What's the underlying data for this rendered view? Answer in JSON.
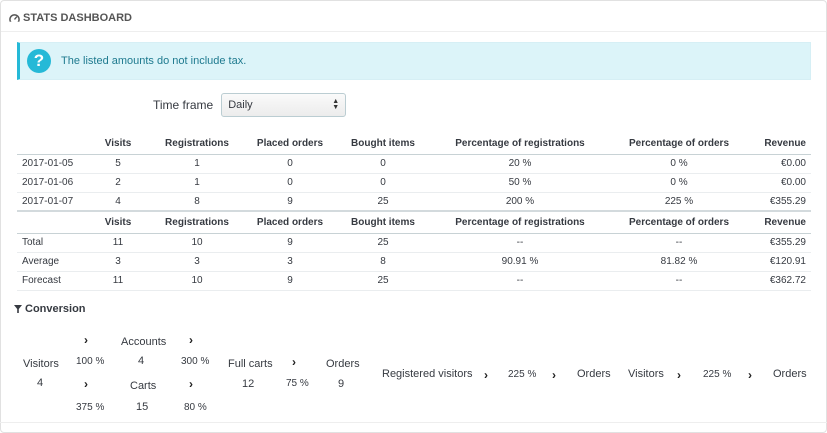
{
  "panel": {
    "title": "Stats Dashboard",
    "icon": "dashboard-icon"
  },
  "alert": {
    "text": "The listed amounts do not include tax.",
    "icon": "question-icon"
  },
  "timeframe": {
    "label": "Time frame",
    "value": "Daily"
  },
  "table": {
    "columns": [
      "",
      "Visits",
      "Registrations",
      "Placed orders",
      "Bought items",
      "Percentage of registrations",
      "Percentage of orders",
      "Revenue"
    ],
    "rows": [
      [
        "2017-01-05",
        "5",
        "1",
        "0",
        "0",
        "20 %",
        "0 %",
        "€0.00"
      ],
      [
        "2017-01-06",
        "2",
        "1",
        "0",
        "0",
        "50 %",
        "0 %",
        "€0.00"
      ],
      [
        "2017-01-07",
        "4",
        "8",
        "9",
        "25",
        "200 %",
        "225 %",
        "€355.29"
      ]
    ],
    "summary_rows": [
      [
        "Total",
        "11",
        "10",
        "9",
        "25",
        "--",
        "--",
        "€355.29"
      ],
      [
        "Average",
        "3",
        "3",
        "3",
        "8",
        "90.91 %",
        "81.82 %",
        "€120.91"
      ],
      [
        "Forecast",
        "11",
        "10",
        "9",
        "25",
        "--",
        "--",
        "€362.72"
      ]
    ]
  },
  "conversion": {
    "title": "Conversion",
    "visitors_label": "Visitors",
    "visitors_value": "4",
    "accounts_label": "Accounts",
    "accounts_value": "4",
    "visitors_to_accounts": "100 %",
    "accounts_to_fullcarts": "300 %",
    "carts_label": "Carts",
    "carts_value": "15",
    "visitors_to_carts": "375 %",
    "carts_to_fullcarts": "80 %",
    "fullcarts_label": "Full carts",
    "fullcarts_value": "12",
    "fullcarts_to_orders": "75 %",
    "orders_label": "Orders",
    "orders_value": "9",
    "registered_visitors_label": "Registered visitors",
    "registered_to_orders": "225 %",
    "orders_label_2": "Orders",
    "visitors_label_2": "Visitors",
    "visitors_to_orders": "225 %",
    "orders_label_3": "Orders"
  }
}
